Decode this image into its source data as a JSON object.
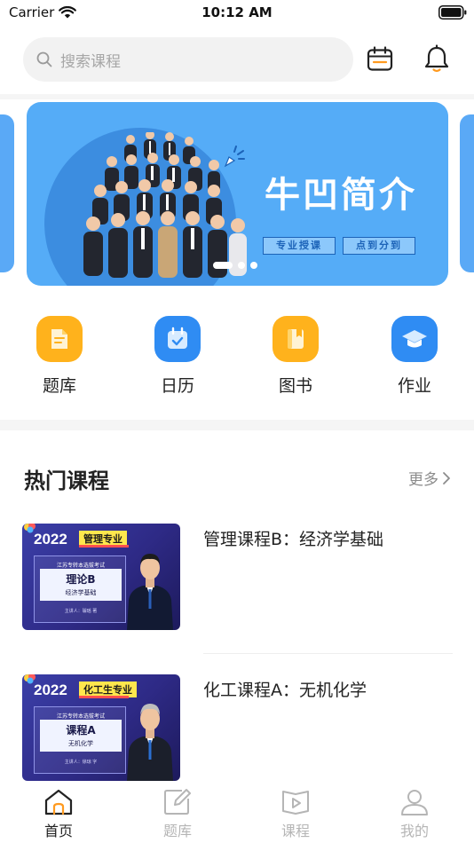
{
  "status_bar": {
    "carrier": "Carrier",
    "time": "10:12 AM"
  },
  "search": {
    "placeholder": "搜索课程"
  },
  "banner": {
    "title": "牛凹简介",
    "tags": [
      "专业授课",
      "点到分到"
    ],
    "slide_count": 3,
    "active_slide": 1
  },
  "quick_nav": [
    {
      "label": "题库",
      "icon": "document-icon",
      "color": "#ffb21c"
    },
    {
      "label": "日历",
      "icon": "calendar-check-icon",
      "color": "#2f8cf3"
    },
    {
      "label": "图书",
      "icon": "book-icon",
      "color": "#ffb21c"
    },
    {
      "label": "作业",
      "icon": "graduation-cap-icon",
      "color": "#2f8cf3"
    }
  ],
  "hot_courses": {
    "title": "热门课程",
    "more": "更多",
    "items": [
      {
        "title": "管理课程B：经济学基础",
        "thumb": {
          "year": "2022",
          "major": "管理专业",
          "exam": "江苏专转本选拔考试",
          "subject": "理论B",
          "subtitle": "经济学基础",
          "teacher": "主讲人：璩瑶 著"
        }
      },
      {
        "title": "化工课程A：无机化学",
        "thumb": {
          "year": "2022",
          "major": "化工生专业",
          "exam": "江苏专转本选拔考试",
          "subject": "课程A",
          "subtitle": "无机化学",
          "teacher": "主讲人：徐琼 字"
        }
      }
    ]
  },
  "tab_bar": {
    "active": "首页",
    "tabs": [
      {
        "label": "首页",
        "icon": "home-icon"
      },
      {
        "label": "题库",
        "icon": "edit-icon"
      },
      {
        "label": "课程",
        "icon": "video-book-icon"
      },
      {
        "label": "我的",
        "icon": "user-icon"
      }
    ]
  },
  "colors": {
    "accent_blue": "#55acf7",
    "accent_orange": "#ffb21c",
    "text_primary": "#222222",
    "text_muted": "#8c8c8c"
  }
}
